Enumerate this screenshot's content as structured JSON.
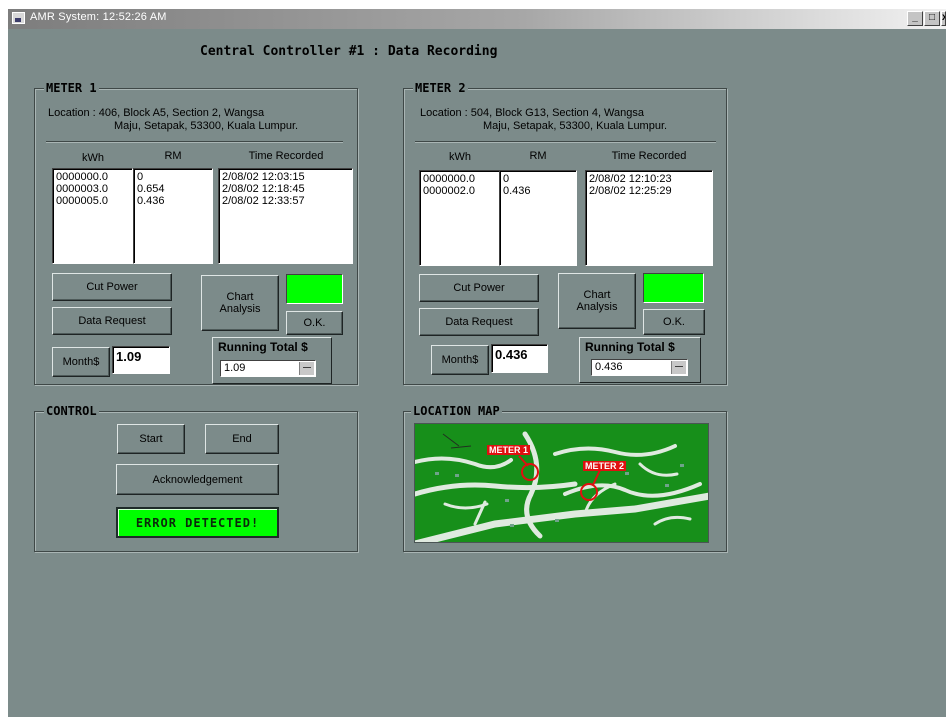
{
  "window": {
    "title": "AMR System: 12:52:26 AM",
    "controls": {
      "minimize": "_",
      "maximize": "□",
      "close": "x"
    }
  },
  "heading": "Central Controller #1 : Data Recording",
  "meter1": {
    "legend": "METER 1",
    "location_line1": "Location : 406, Block A5, Section 2, Wangsa",
    "location_line2": "Maju, Setapak, 53300, Kuala Lumpur.",
    "columns": {
      "kwh": "kWh",
      "rm": "RM",
      "time": "Time Recorded"
    },
    "kwh": "0000000.0\n0000003.0\n0000005.0",
    "rm": "0\n0.654\n0.436",
    "time": "2/08/02 12:03:15\n2/08/02 12:18:45\n2/08/02 12:33:57",
    "cut_power": "Cut Power",
    "data_request": "Data Request",
    "chart_analysis": "Chart Analysis",
    "ok": "O.K.",
    "month_button": "Month$",
    "month_value": "1.09",
    "running_total_label": "Running Total $",
    "running_total_value": "1.09"
  },
  "meter2": {
    "legend": "METER 2",
    "location_line1": "Location : 504, Block G13, Section 4, Wangsa",
    "location_line2": "Maju, Setapak, 53300, Kuala Lumpur.",
    "columns": {
      "kwh": "kWh",
      "rm": "RM",
      "time": "Time Recorded"
    },
    "kwh": "0000000.0\n0000002.0",
    "rm": "0\n0.436",
    "time": "2/08/02 12:10:23\n2/08/02 12:25:29",
    "cut_power": "Cut Power",
    "data_request": "Data Request",
    "chart_analysis": "Chart Analysis",
    "ok": "O.K.",
    "month_button": "Month$",
    "month_value": "0.436",
    "running_total_label": "Running Total $",
    "running_total_value": "0.436"
  },
  "control": {
    "legend": "CONTROL",
    "start": "Start",
    "end": "End",
    "acknowledgement": "Acknowledgement",
    "status": "ERROR DETECTED!"
  },
  "location_map": {
    "legend": "LOCATION MAP",
    "marker1": "METER 1",
    "marker2": "METER 2"
  },
  "colors": {
    "window_bg": "#7c8b8a",
    "indicator_green": "#00ff00",
    "map_green": "#178f1a",
    "marker_red": "#e01010"
  }
}
